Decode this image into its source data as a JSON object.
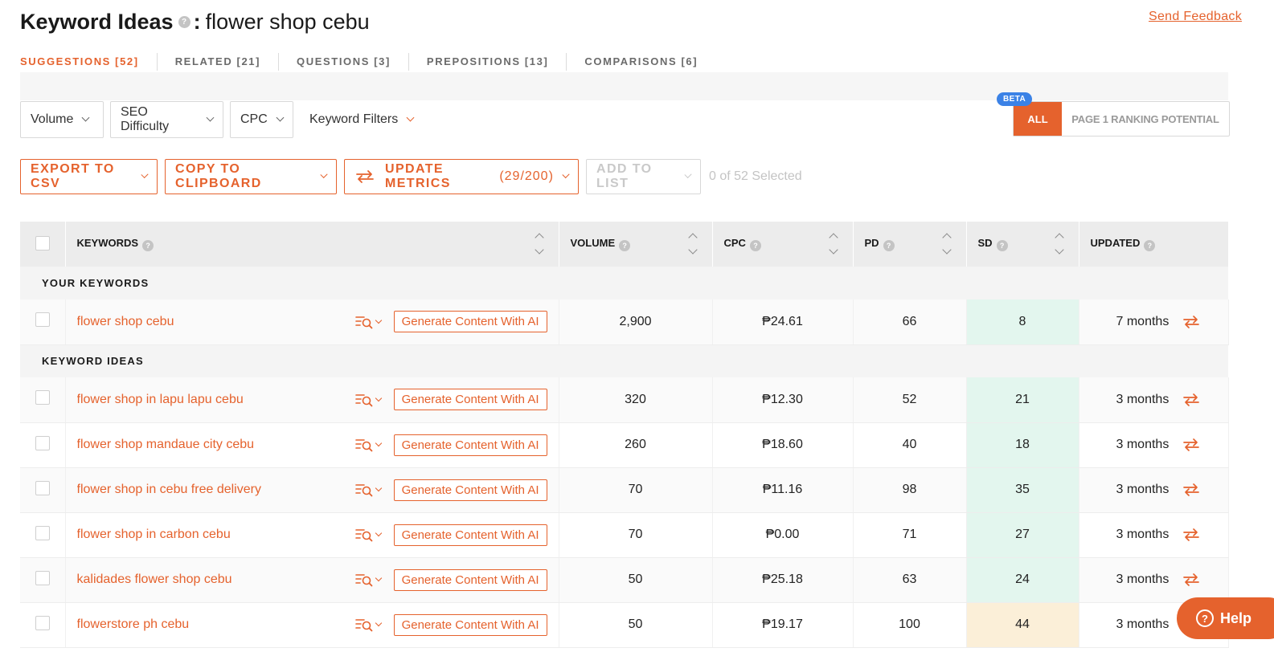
{
  "header": {
    "title": "Keyword Ideas",
    "colon": ":",
    "query": "flower shop cebu",
    "feedback": "Send Feedback"
  },
  "tabs": [
    {
      "label": "SUGGESTIONS [52]",
      "active": true
    },
    {
      "label": "RELATED [21]"
    },
    {
      "label": "QUESTIONS [3]"
    },
    {
      "label": "PREPOSITIONS [13]"
    },
    {
      "label": "COMPARISONS [6]"
    }
  ],
  "filters": {
    "volume": "Volume",
    "seo_difficulty": "SEO Difficulty",
    "cpc": "CPC",
    "keyword_filters": "Keyword Filters",
    "beta": "BETA",
    "all": "ALL",
    "page1": "PAGE 1 RANKING POTENTIAL"
  },
  "actions": {
    "export": "EXPORT TO CSV",
    "copy": "COPY TO CLIPBOARD",
    "update": "UPDATE METRICS",
    "update_count": "(29/200)",
    "add_list": "ADD TO LIST",
    "selected": "0 of 52 Selected"
  },
  "table": {
    "headers": {
      "keywords": "KEYWORDS",
      "volume": "VOLUME",
      "cpc": "CPC",
      "pd": "PD",
      "sd": "SD",
      "updated": "UPDATED"
    },
    "group_yours": "YOUR KEYWORDS",
    "group_ideas": "KEYWORD IDEAS",
    "generate_label": "Generate Content With AI",
    "your_rows": [
      {
        "keyword": "flower shop cebu",
        "volume": "2,900",
        "cpc": "₱24.61",
        "pd": "66",
        "sd": "8",
        "sd_level": "green",
        "updated": "7 months"
      }
    ],
    "idea_rows": [
      {
        "keyword": "flower shop in lapu lapu cebu",
        "volume": "320",
        "cpc": "₱12.30",
        "pd": "52",
        "sd": "21",
        "sd_level": "green",
        "updated": "3 months"
      },
      {
        "keyword": "flower shop mandaue city cebu",
        "volume": "260",
        "cpc": "₱18.60",
        "pd": "40",
        "sd": "18",
        "sd_level": "green",
        "updated": "3 months"
      },
      {
        "keyword": "flower shop in cebu free delivery",
        "volume": "70",
        "cpc": "₱11.16",
        "pd": "98",
        "sd": "35",
        "sd_level": "green",
        "updated": "3 months"
      },
      {
        "keyword": "flower shop in carbon cebu",
        "volume": "70",
        "cpc": "₱0.00",
        "pd": "71",
        "sd": "27",
        "sd_level": "green",
        "updated": "3 months"
      },
      {
        "keyword": "kalidades flower shop cebu",
        "volume": "50",
        "cpc": "₱25.18",
        "pd": "63",
        "sd": "24",
        "sd_level": "green",
        "updated": "3 months"
      },
      {
        "keyword": "flowerstore ph cebu",
        "volume": "50",
        "cpc": "₱19.17",
        "pd": "100",
        "sd": "44",
        "sd_level": "yellow",
        "updated": "3 months"
      }
    ]
  },
  "help_widget": {
    "label": "Help"
  },
  "colors": {
    "accent": "#e5622d",
    "beta": "#3b82e6",
    "sd_green": "#e3f6ee",
    "sd_yellow": "#fbefd8"
  }
}
